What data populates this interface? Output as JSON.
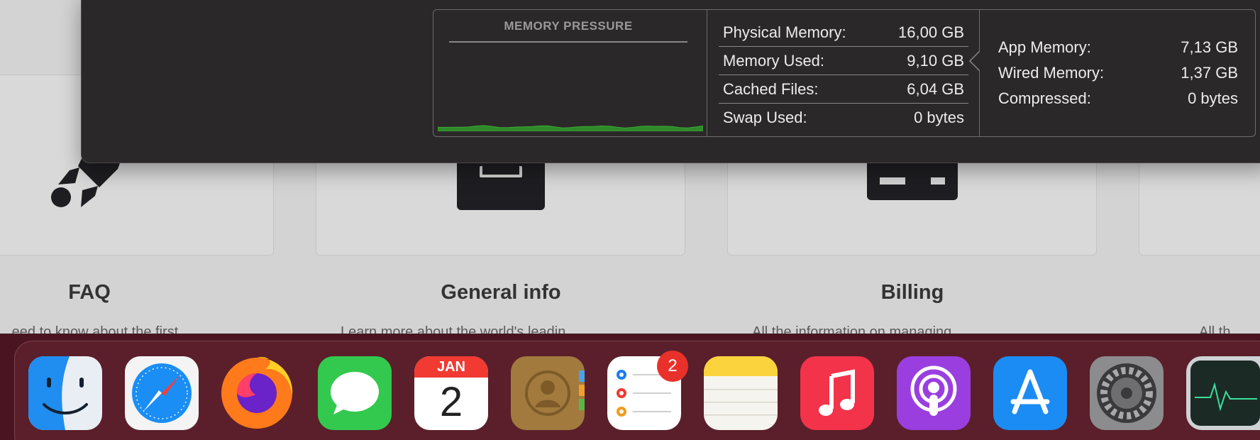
{
  "background_page": {
    "cards": [
      {
        "title": "FAQ",
        "description": "...eed to know about the first..."
      },
      {
        "title": "General info",
        "description": "Learn more about the world's leadin..."
      },
      {
        "title": "Billing",
        "description": "All the information on managing..."
      },
      {
        "title": "",
        "description": "All th..."
      }
    ]
  },
  "activity_monitor": {
    "memory_pressure": {
      "title": "MEMORY PRESSURE",
      "graph_color": "#2f8a2a",
      "level": 0.06
    },
    "stats": [
      {
        "label": "Physical Memory:",
        "value": "16,00 GB"
      },
      {
        "label": "Memory Used:",
        "value": "9,10 GB"
      },
      {
        "label": "Cached Files:",
        "value": "6,04 GB"
      },
      {
        "label": "Swap Used:",
        "value": "0 bytes"
      }
    ],
    "details": [
      {
        "label": "App Memory:",
        "value": "7,13 GB"
      },
      {
        "label": "Wired Memory:",
        "value": "1,37 GB"
      },
      {
        "label": "Compressed:",
        "value": "0 bytes"
      }
    ]
  },
  "dock": {
    "apps": [
      {
        "name": "Finder",
        "icon": "finder-icon"
      },
      {
        "name": "Safari",
        "icon": "safari-icon"
      },
      {
        "name": "Firefox",
        "icon": "firefox-icon"
      },
      {
        "name": "Messages",
        "icon": "messages-icon"
      },
      {
        "name": "Calendar",
        "icon": "calendar-icon",
        "month": "JAN",
        "day": "2"
      },
      {
        "name": "Contacts",
        "icon": "contacts-icon"
      },
      {
        "name": "Reminders",
        "icon": "reminders-icon",
        "badge": "2"
      },
      {
        "name": "Notes",
        "icon": "notes-icon"
      },
      {
        "name": "Music",
        "icon": "music-icon"
      },
      {
        "name": "Podcasts",
        "icon": "podcasts-icon"
      },
      {
        "name": "App Store",
        "icon": "app-store-icon"
      },
      {
        "name": "System Preferences",
        "icon": "system-preferences-icon"
      },
      {
        "name": "Activity Monitor",
        "icon": "activity-monitor-icon"
      }
    ]
  }
}
